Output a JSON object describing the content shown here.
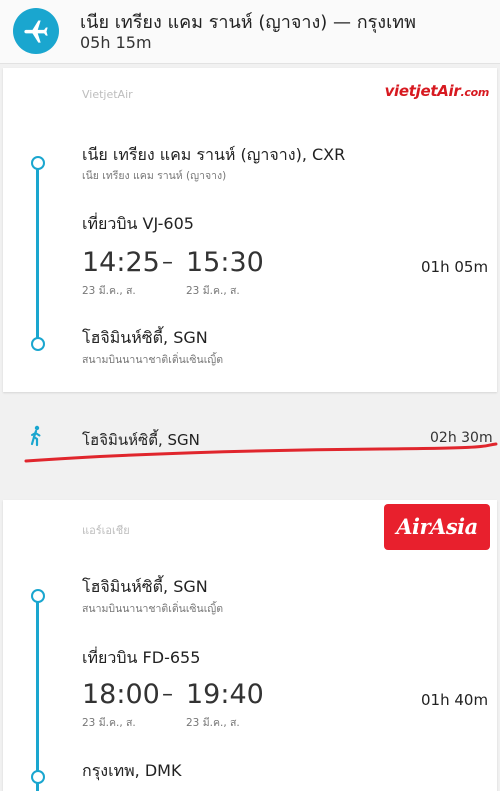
{
  "header": {
    "route": "เนีย เทรียง แคม รานห์ (ญาจาง) — กรุงเทพ",
    "duration": "05h 15m",
    "icon": "airplane-icon",
    "accent": "#1aa6cf"
  },
  "segment1": {
    "airline_name": "VietjetAir",
    "logo_main": "vietjetAir",
    "logo_suffix": ".com",
    "depart_place": "เนีย เทรียง แคม รานห์ (ญาจาง), CXR",
    "depart_airport": "เนีย เทรียง แคม รานห์ (ญาจาง)",
    "flight_no": "เที่ยวบิน VJ-605",
    "depart_time": "14:25",
    "arrive_time": "15:30",
    "depart_date": "23 มี.ค., ส.",
    "arrive_date": "23 มี.ค., ส.",
    "duration": "01h 05m",
    "arrive_place": "โฮจิมินห์ซิตี้, SGN",
    "arrive_airport": "สนามบินนานาชาติเติ่นเซินเญิ้ต"
  },
  "layover": {
    "icon": "walking-person-icon",
    "place": "โฮจิมินห์ซิตี้, SGN",
    "duration": "02h 30m"
  },
  "segment2": {
    "airline_name": "แอร์เอเชีย",
    "logo_text": "AirAsia",
    "depart_place": "โฮจิมินห์ซิตี้, SGN",
    "depart_airport": "สนามบินนานาชาติเติ่นเซินเญิ้ต",
    "flight_no": "เที่ยวบิน FD-655",
    "depart_time": "18:00",
    "arrive_time": "19:40",
    "depart_date": "23 มี.ค., ส.",
    "arrive_date": "23 มี.ค., ส.",
    "duration": "01h 40m",
    "arrive_place": "กรุงเทพ, DMK"
  }
}
